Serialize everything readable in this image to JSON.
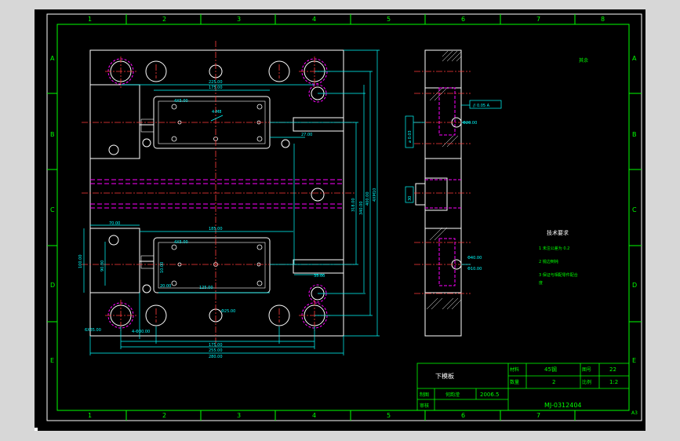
{
  "colors": {
    "frame": "#ffffff",
    "line": "#00ff00",
    "dim": "#00ffff",
    "center": "#ff3b3b",
    "hidden": "#ff00ff"
  },
  "grid": {
    "cols": [
      "1",
      "2",
      "3",
      "4",
      "5",
      "6",
      "7",
      "8"
    ],
    "rows": [
      "A",
      "B",
      "C",
      "D",
      "E"
    ]
  },
  "titleblock": {
    "part_name": "下模板",
    "material_label": "材料",
    "material": "45钢",
    "drawing_no_label": "图号",
    "drawing_no": "22",
    "qty_label": "数量",
    "qty": "2",
    "scale_label": "比例",
    "scale": "1:2",
    "drawn_label": "制图",
    "drawer": "何韵滢",
    "date": "2006.5",
    "review_label": "审核",
    "code": "MJ-0312404",
    "sheet": "A3"
  },
  "notes": {
    "other": "其余",
    "title": "技术要求",
    "items": [
      "1 未注公差为 0.2",
      "2 锐边倒钝",
      "3 保证与相配零件配合"
    ],
    "item3_cont": "度"
  },
  "dims": {
    "d_225": "225.00",
    "d_175t": "175.00",
    "d_185": "185.00",
    "d_70": "70.00",
    "d_100": "100.00",
    "d_90": "90.00",
    "d_2x": "4X5.00",
    "d_msp": "4-M8",
    "d_27": "27.00",
    "d_125": "125.00",
    "d_10": "10.00",
    "d_175b": "175.00",
    "d_255": "255.00",
    "d_280": "280.00",
    "d_318": "318.00",
    "d_400": "400.00",
    "d_340": "340.00",
    "d_4m": "4XM10",
    "d_20": "20.00",
    "d_4phi": "4-Φ30.00",
    "d_35": "35.00",
    "d_6": "6X35.00",
    "d_phi25": "Φ25.00",
    "d_phi40": "Φ40.00",
    "d_phi20": "Φ20.00",
    "d_phi10": "Φ10.00",
    "d_side": "30",
    "tol_box": "// 0.05 A",
    "tol_box2": "⌀ 0.03",
    "rough": "Ra"
  }
}
